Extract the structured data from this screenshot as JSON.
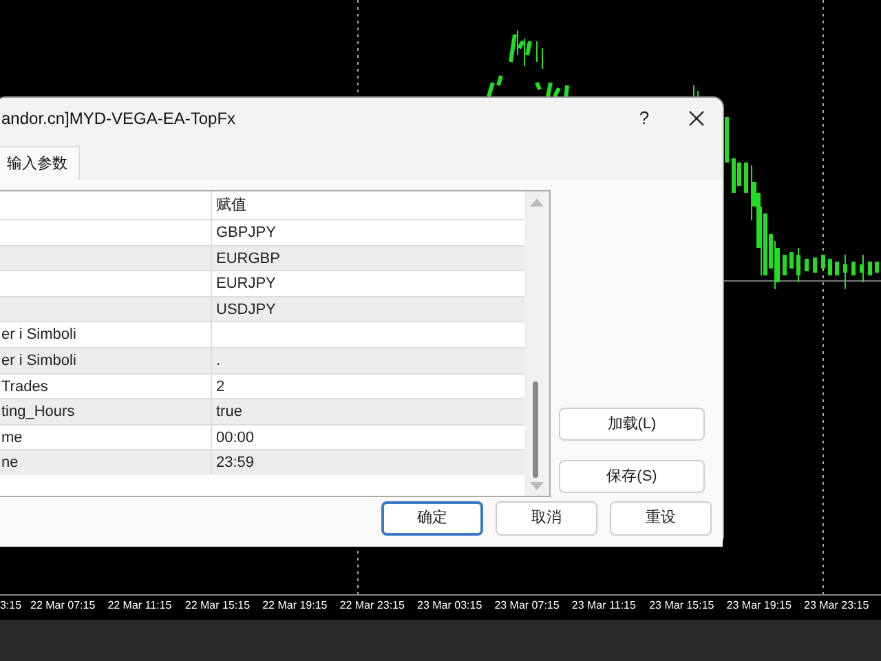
{
  "chart": {
    "time_labels": [
      "3:15",
      "22 Mar 07:15",
      "22 Mar 11:15",
      "22 Mar 15:15",
      "22 Mar 19:15",
      "22 Mar 23:15",
      "23 Mar 03:15",
      "23 Mar 07:15",
      "23 Mar 11:15",
      "23 Mar 15:15",
      "23 Mar 19:15",
      "23 Mar 23:15"
    ]
  },
  "dialog": {
    "title": "andor.cn]MYD-VEGA-EA-TopFx",
    "help": "?",
    "tabs": [
      {
        "label": "输入参数",
        "selected": true
      }
    ],
    "table": {
      "value_column": "赋值",
      "rows": [
        {
          "value": "GBPJPY"
        },
        {
          "value": "EURGBP"
        },
        {
          "value": "EURJPY"
        },
        {
          "value": "USDJPY"
        },
        {
          "parameter": "er i Simboli"
        },
        {
          "parameter": "er i Simboli",
          "value": "."
        },
        {
          "parameter": "Trades",
          "value": "2"
        },
        {
          "parameter": "ting_Hours",
          "value": "true"
        },
        {
          "parameter": "me",
          "value": "00:00"
        },
        {
          "parameter": "ne",
          "value": "23:59"
        }
      ]
    },
    "side_buttons": [
      "加载(L)",
      "保存(S)"
    ],
    "buttons": [
      {
        "label": "确定",
        "default": true
      },
      {
        "label": "取消",
        "default": false
      },
      {
        "label": "重设",
        "default": false
      }
    ]
  }
}
